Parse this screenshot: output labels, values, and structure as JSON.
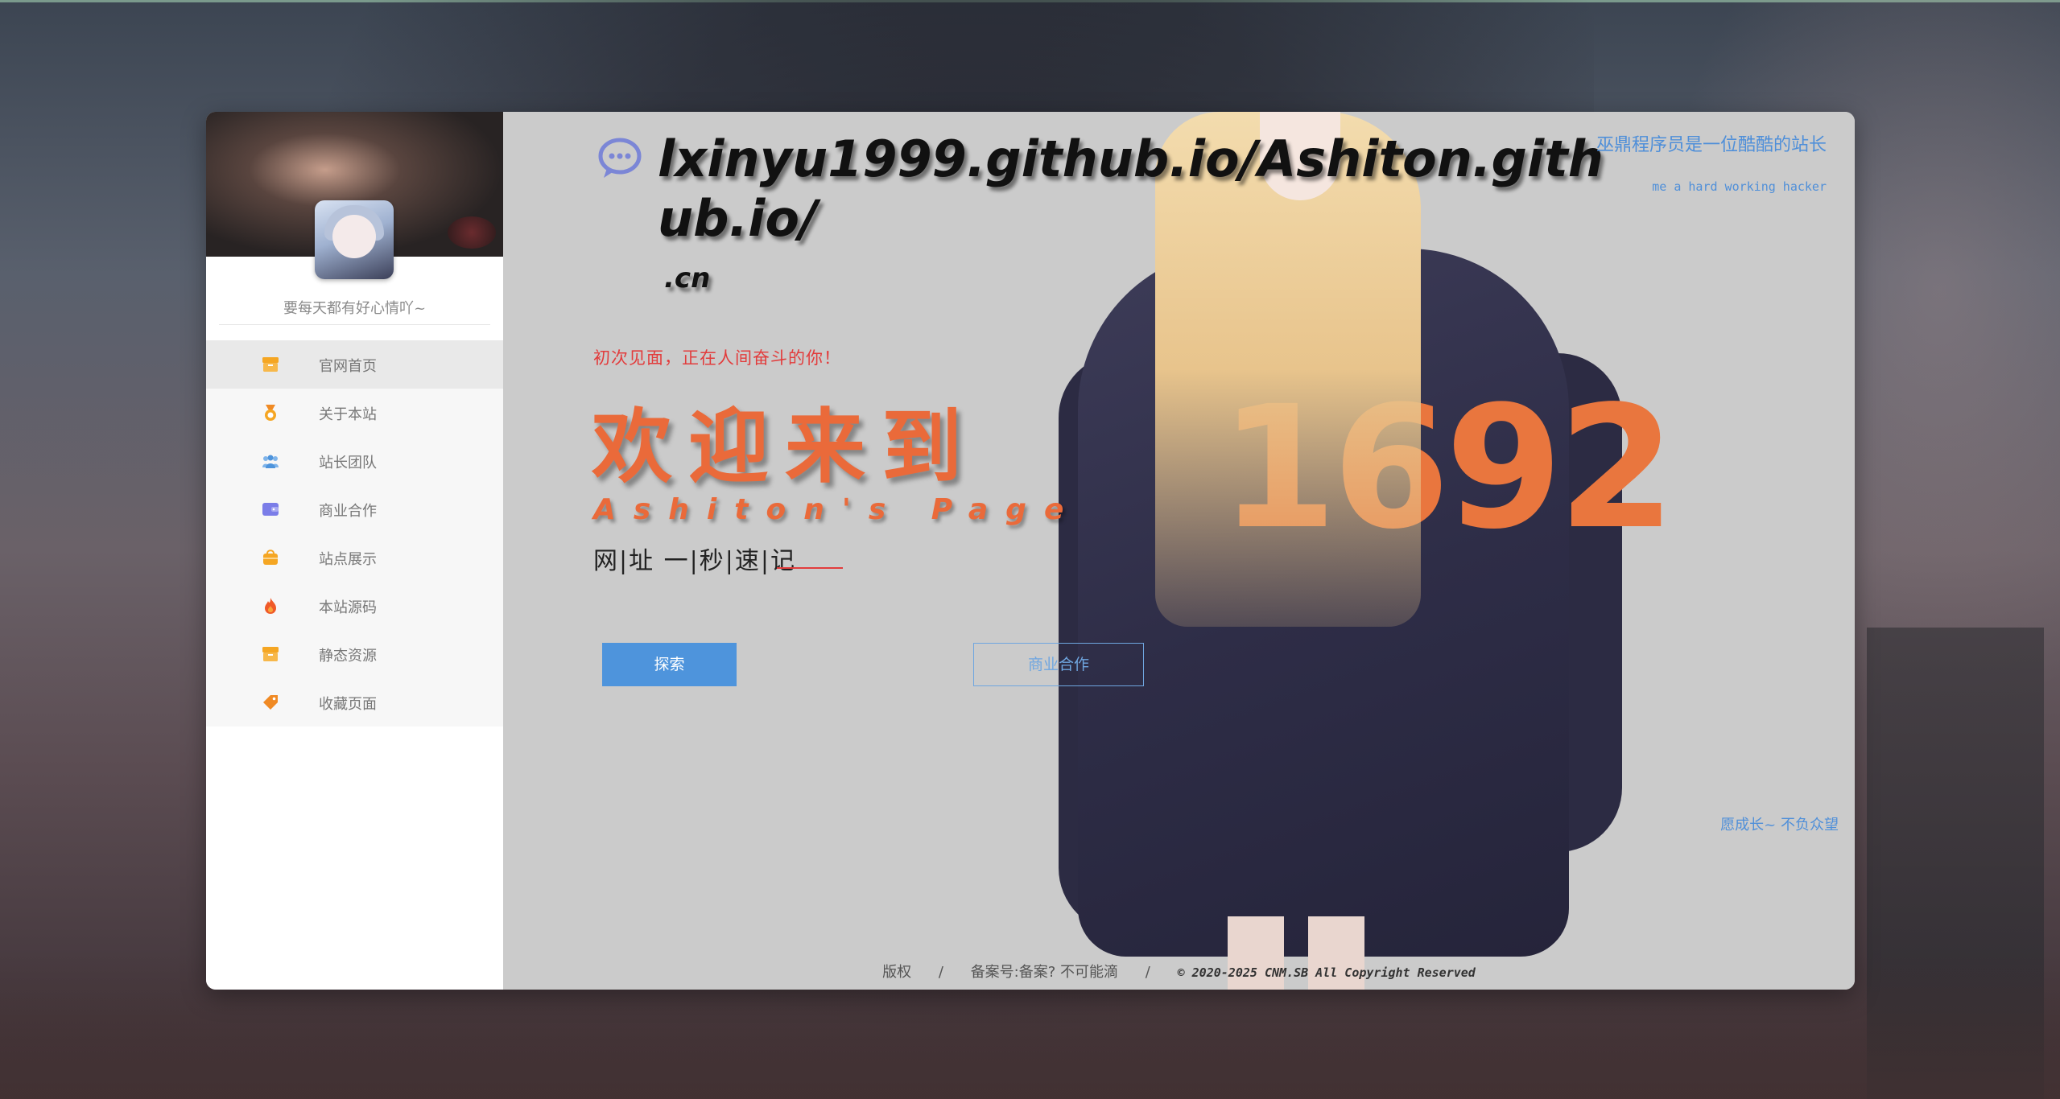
{
  "site": {
    "title": "lxinyu1999.github.io/Ashiton.github.io/",
    "title_suffix": ".cn",
    "tagline_cn": "巫鼎程序员是一位酷酷的站长",
    "tagline_en": "me a hard working hacker"
  },
  "sidebar": {
    "motto": "要每天都有好心情吖~",
    "items": [
      {
        "label": "官网首页",
        "icon": "box-icon",
        "color": "#f5a623",
        "active": true
      },
      {
        "label": "关于本站",
        "icon": "medal-icon",
        "color": "#f08a24"
      },
      {
        "label": "站长团队",
        "icon": "team-icon",
        "color": "#4e94dc"
      },
      {
        "label": "商业合作",
        "icon": "wallet-icon",
        "color": "#7b7de8"
      },
      {
        "label": "站点展示",
        "icon": "bag-icon",
        "color": "#f5a623"
      },
      {
        "label": "本站源码",
        "icon": "fire-icon",
        "color": "#f05a28"
      },
      {
        "label": "静态资源",
        "icon": "box-icon",
        "color": "#f5a623"
      },
      {
        "label": "收藏页面",
        "icon": "tag-icon",
        "color": "#f08a24"
      }
    ]
  },
  "hero": {
    "greeting": "初次见面，正在人间奋斗的你！",
    "welcome": "欢迎来到",
    "page_name": "Ashiton's Page",
    "subtitle": "网|址  一|秒|速|记",
    "explore_button": "探索",
    "business_button": "商业合作",
    "motto_right": "愿成长~ 不负众望",
    "shirt_number": "1692"
  },
  "footer": {
    "copyright_label": "版权",
    "separator": "/",
    "record": "备案号:备案? 不可能滴",
    "copyright_text": "© 2020-2025 CNM.SB All Copyright Reserved"
  },
  "colors": {
    "accent_blue": "#4e94dc",
    "accent_orange": "#ea6a3a",
    "greeting_red": "#e23c3c"
  }
}
